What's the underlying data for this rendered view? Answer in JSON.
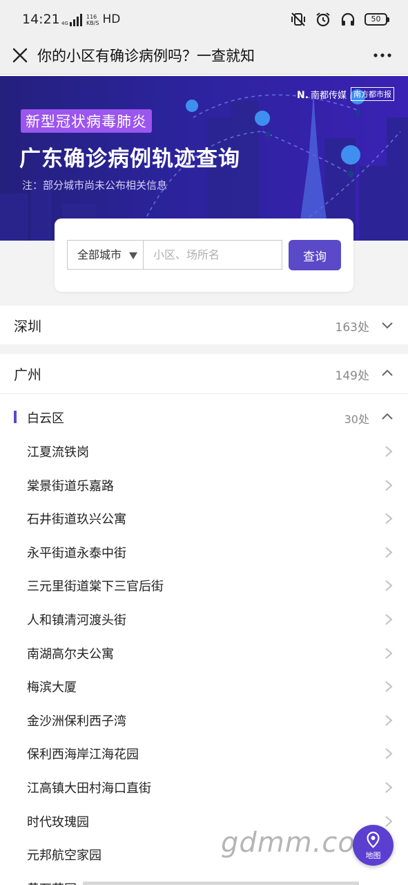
{
  "status_bar": {
    "time": "14:21",
    "network_gen": "4G",
    "speed_value": "116",
    "speed_unit": "KB/S",
    "hd": "HD",
    "battery": "50"
  },
  "header": {
    "title": "你的小区有确诊病例吗？一查就知",
    "close_icon": "close-icon",
    "more_icon": "more-icon"
  },
  "banner": {
    "brand_mark": "N.",
    "brand_name": "南都传媒",
    "brand_paper": "南方都市报",
    "tag": "新型冠状病毒肺炎",
    "title": "广东确诊病例轨迹查询",
    "note": "注：部分城市尚未公布相关信息"
  },
  "search": {
    "city_value": "全部城市",
    "placeholder": "小区、场所名",
    "button": "查询"
  },
  "cities": [
    {
      "name": "深圳",
      "count": "163处",
      "expanded": false
    },
    {
      "name": "广州",
      "count": "149处",
      "expanded": true
    }
  ],
  "district": {
    "name": "白云区",
    "count": "30处"
  },
  "places": [
    "江夏流铁岗",
    "棠景街道乐嘉路",
    "石井街道玖兴公寓",
    "永平街道永泰中街",
    "三元里街道棠下三官后街",
    "人和镇清河渡头街",
    "南湖高尔夫公寓",
    "梅滨大厦",
    "金沙洲保利西子湾",
    "保利西海岸江海花园",
    "江高镇大田村海口直街",
    "时代玫瑰园",
    "元邦航空家园",
    "黄石花园"
  ],
  "map_button": "地图",
  "watermark": "gdmm.com",
  "colors": {
    "accent": "#5a4ac7",
    "banner_bg": "#2b239a",
    "tag_bg": "#9b56ee",
    "map_button": "#5b3fd0"
  }
}
